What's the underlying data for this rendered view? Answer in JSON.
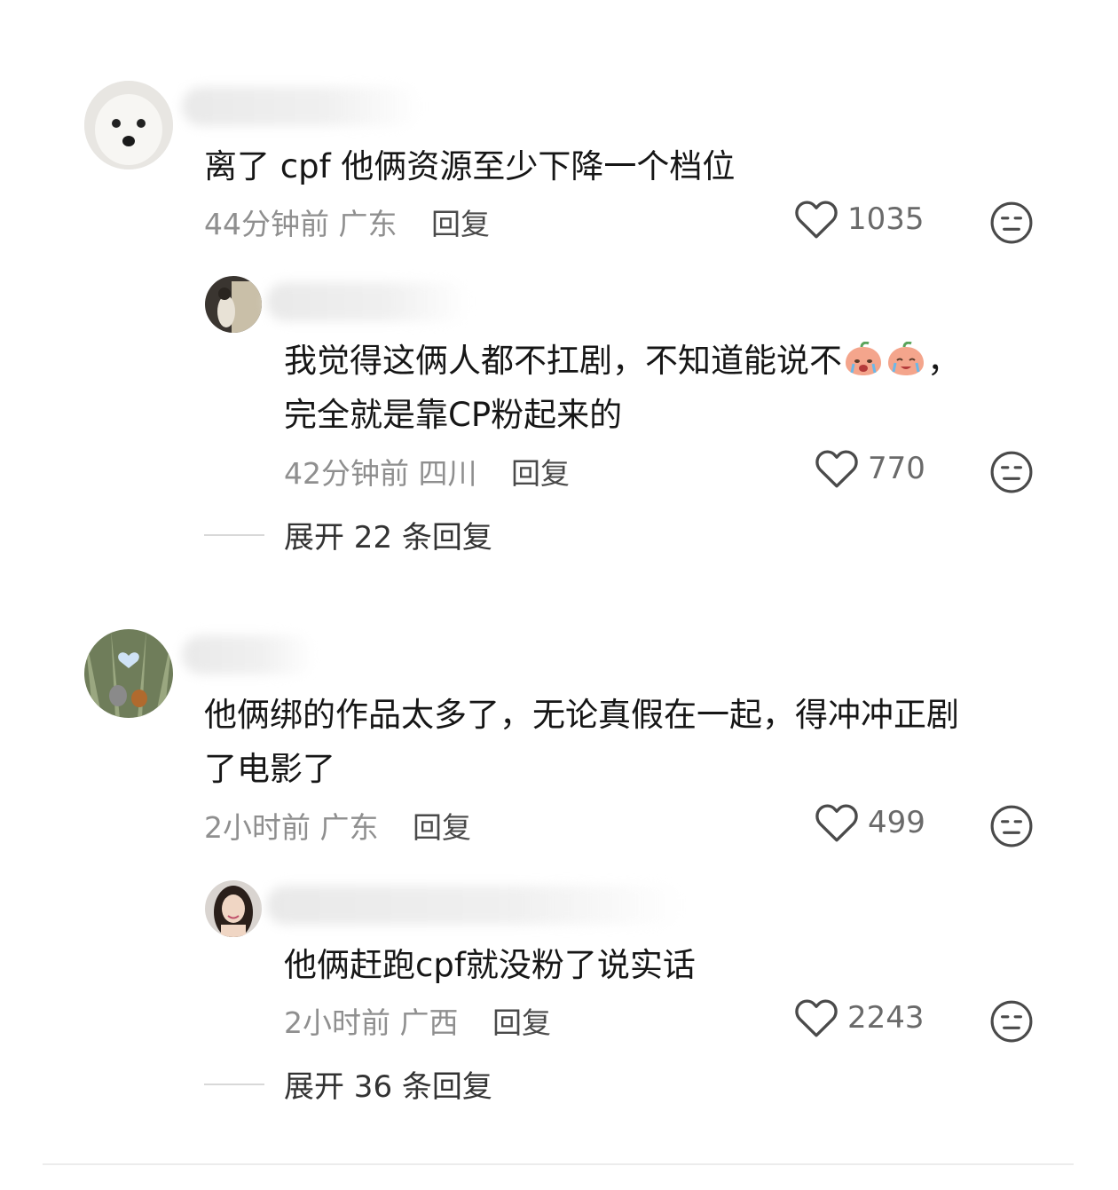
{
  "comments": [
    {
      "text": "离了 cpf 他俩资源至少下降一个档位",
      "time": "44分钟前",
      "location": "广东",
      "reply_label": "回复",
      "likes": "1035",
      "avatar_icon": "white-dog-avatar",
      "reply": {
        "text_line1": "我觉得这俩人都不扛剧，不知道能说不",
        "text_line1_end": "，",
        "text_line2": "完全就是靠CP粉起来的",
        "emojis": [
          "crying-peach-emoji",
          "crying-peach-emoji"
        ],
        "time": "42分钟前",
        "location": "四川",
        "reply_label": "回复",
        "likes": "770",
        "avatar_icon": "photo-avatar"
      },
      "expand_label": "展开 22 条回复"
    },
    {
      "text_line1": "他俩绑的作品太多了，无论真假在一起，得冲冲正剧",
      "text_line2": "了电影了",
      "time": "2小时前",
      "location": "广东",
      "reply_label": "回复",
      "likes": "499",
      "avatar_icon": "forest-bunny-avatar",
      "reply": {
        "text": "他俩赶跑cpf就没粉了说实话",
        "time": "2小时前",
        "location": "广西",
        "reply_label": "回复",
        "likes": "2243",
        "avatar_icon": "woman-photo-avatar"
      },
      "expand_label": "展开 36 条回复"
    }
  ],
  "colors": {
    "text": "#161616",
    "meta": "#8f8f8f",
    "icon": "#4a4a4a"
  }
}
